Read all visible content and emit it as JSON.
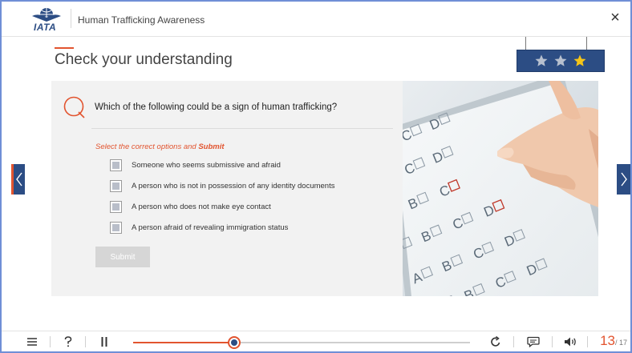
{
  "header": {
    "logo_text": "IATA",
    "course_title": "Human Trafficking Awareness",
    "close_label": "×"
  },
  "main": {
    "title": "Check your understanding",
    "stars": {
      "earned": 1,
      "total": 3,
      "active_color": "#f5c518",
      "inactive_color": "#b7c0cf"
    },
    "question": "Which of the following could be a sign of human trafficking?",
    "instruction_prefix": "Select the correct options and ",
    "instruction_emphasis": "Submit",
    "options": [
      {
        "label": "Someone who seems submissive and afraid",
        "checked": false
      },
      {
        "label": "A person who is not in possession of any identity documents",
        "checked": false
      },
      {
        "label": "A person who does not make eye contact",
        "checked": false
      },
      {
        "label": "A person afraid of revealing immigration status",
        "checked": false
      }
    ],
    "submit_label": "Submit"
  },
  "footer": {
    "progress_fraction": 0.3,
    "page_current": "13",
    "page_total": "/ 17"
  },
  "colors": {
    "accent": "#e2542f",
    "brand_navy": "#2c4d84"
  },
  "icons": {
    "menu": "menu-icon",
    "help": "help-icon",
    "pause": "pause-icon",
    "replay": "replay-icon",
    "transcript": "transcript-icon",
    "audio": "volume-icon"
  }
}
